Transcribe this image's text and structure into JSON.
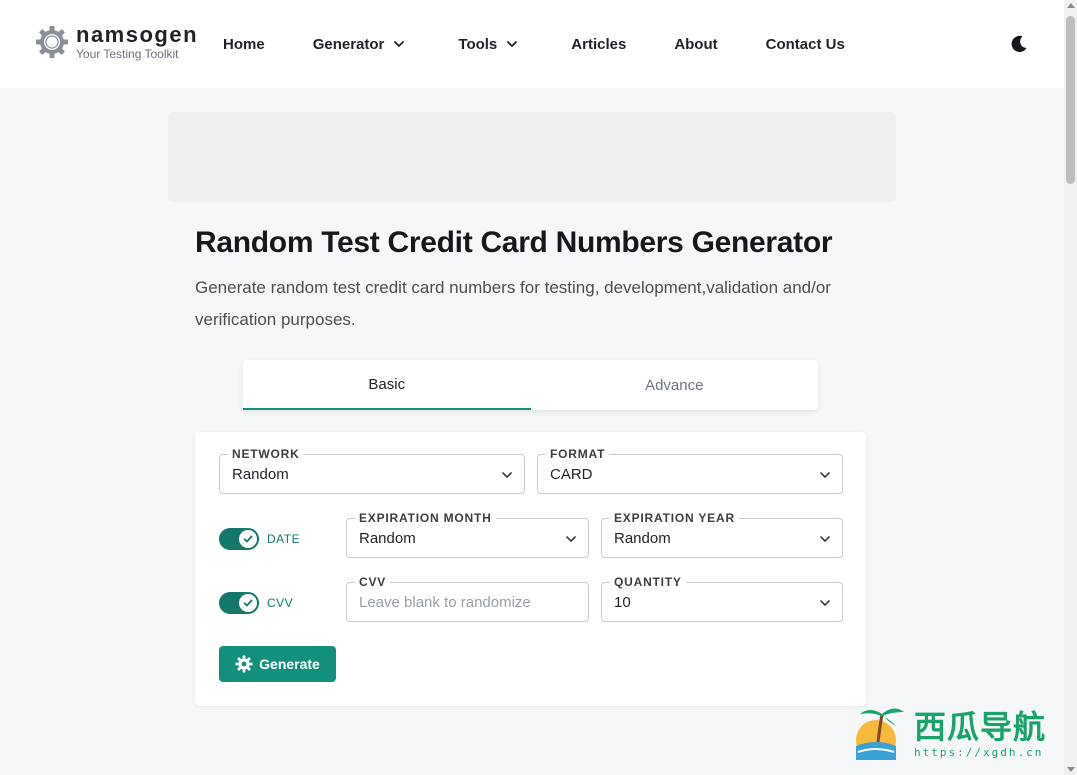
{
  "brand": {
    "name": "namsogen",
    "tagline": "Your Testing Toolkit"
  },
  "nav": {
    "items": [
      {
        "label": "Home",
        "has_dropdown": false
      },
      {
        "label": "Generator",
        "has_dropdown": true
      },
      {
        "label": "Tools",
        "has_dropdown": true
      },
      {
        "label": "Articles",
        "has_dropdown": false
      },
      {
        "label": "About",
        "has_dropdown": false
      },
      {
        "label": "Contact Us",
        "has_dropdown": false
      }
    ],
    "theme_icon": "moon-icon"
  },
  "page": {
    "title": "Random Test Credit Card Numbers Generator",
    "subtitle": "Generate random test credit card numbers for testing, development,validation and/or verification purposes."
  },
  "tabs": [
    {
      "label": "Basic",
      "active": true
    },
    {
      "label": "Advance",
      "active": false
    }
  ],
  "form": {
    "network": {
      "label": "NETWORK",
      "value": "Random"
    },
    "format": {
      "label": "FORMAT",
      "value": "CARD"
    },
    "date_toggle": {
      "label": "DATE",
      "on": true
    },
    "expiration_month": {
      "label": "EXPIRATION MONTH",
      "value": "Random"
    },
    "expiration_year": {
      "label": "EXPIRATION YEAR",
      "value": "Random"
    },
    "cvv_toggle": {
      "label": "CVV",
      "on": true
    },
    "cvv": {
      "label": "CVV",
      "value": "",
      "placeholder": "Leave blank to randomize"
    },
    "quantity": {
      "label": "QUANTITY",
      "value": "10"
    },
    "generate_label": "Generate"
  },
  "watermark": {
    "text": "西瓜导航",
    "url": "https://xgdh.cn"
  },
  "colors": {
    "accent": "#13907c",
    "toggle": "#13786a",
    "watermark": "#1aa36a"
  }
}
